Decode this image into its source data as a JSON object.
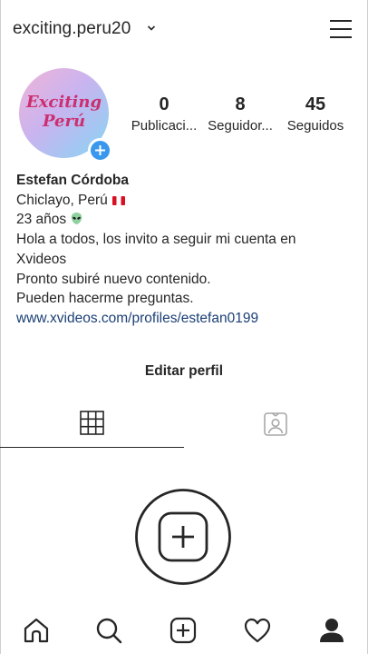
{
  "header": {
    "username": "exciting.peru20",
    "dropdown_icon": "chevron-down-icon",
    "menu_icon": "hamburger-menu-icon"
  },
  "profile": {
    "avatar_text_line1": "Exciting",
    "avatar_text_line2": "Perú",
    "add_story_icon": "plus-icon",
    "stats": [
      {
        "value": "0",
        "label": "Publicaci..."
      },
      {
        "value": "8",
        "label": "Seguidor..."
      },
      {
        "value": "45",
        "label": "Seguidos"
      }
    ]
  },
  "bio": {
    "name": "Estefan Córdoba",
    "location": "Chiclayo, Perú",
    "location_icon": "peru-flag-icon",
    "age": "23 años",
    "age_icon": "alien-icon",
    "line1": "Hola a todos, los invito a seguir mi cuenta en",
    "line2": "Xvideos",
    "line3": "Pronto subiré nuevo contenido.",
    "line4": "Pueden hacerme preguntas.",
    "link": "www.xvideos.com/profiles/estefan0199"
  },
  "actions": {
    "edit_profile": "Editar perfil"
  },
  "tabs": [
    {
      "icon": "grid-icon",
      "active": true
    },
    {
      "icon": "tagged-person-icon",
      "active": false
    }
  ],
  "content": {
    "add_icon": "add-post-icon"
  },
  "bottom_nav": [
    {
      "icon": "home-icon"
    },
    {
      "icon": "search-icon"
    },
    {
      "icon": "new-post-icon"
    },
    {
      "icon": "heart-icon"
    },
    {
      "icon": "profile-icon"
    }
  ],
  "colors": {
    "text": "#262626",
    "link": "#1b3f75",
    "badge": "#3a97ee",
    "avatar_text": "#cc2f6f"
  }
}
